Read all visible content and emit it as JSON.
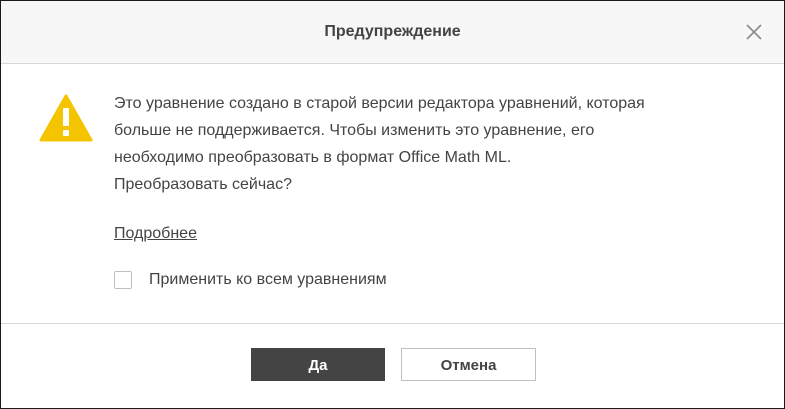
{
  "dialog": {
    "title": "Предупреждение",
    "close_icon": "close-icon",
    "warning_icon": "warning-triangle-icon",
    "warning_color": "#f5c400",
    "message_lines": [
      "Это уравнение создано в старой версии редактора уравнений, которая",
      "больше не поддерживается. Чтобы изменить это уравнение, его",
      "необходимо преобразовать в формат Office Math ML.",
      "Преобразовать сейчас?"
    ],
    "more_link": "Подробнее",
    "apply_all_label": "Применить ко всем уравнениям",
    "apply_all_checked": false,
    "ok_label": "Да",
    "cancel_label": "Отмена",
    "primary_button_color": "#444444"
  }
}
